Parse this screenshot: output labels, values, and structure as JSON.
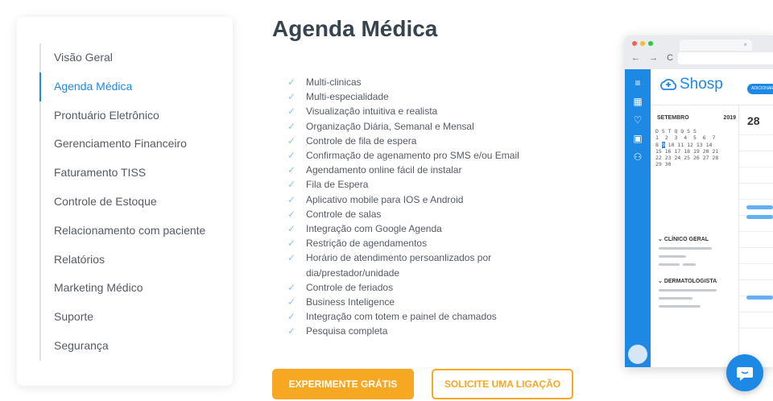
{
  "sidebar": {
    "items": [
      {
        "label": "Visão Geral",
        "active": false
      },
      {
        "label": "Agenda Médica",
        "active": true
      },
      {
        "label": "Prontuário Eletrônico",
        "active": false
      },
      {
        "label": "Gerenciamento Financeiro",
        "active": false
      },
      {
        "label": "Faturamento TISS",
        "active": false
      },
      {
        "label": "Controle de Estoque",
        "active": false
      },
      {
        "label": "Relacionamento com paciente",
        "active": false
      },
      {
        "label": "Relatórios",
        "active": false
      },
      {
        "label": "Marketing Médico",
        "active": false
      },
      {
        "label": "Suporte",
        "active": false
      },
      {
        "label": "Segurança",
        "active": false
      }
    ]
  },
  "main": {
    "title": "Agenda Médica",
    "features": [
      "Multi-clinicas",
      "Multi-especialidade",
      "Visualização intuitiva e realista",
      "Organização Diária, Semanal e Mensal",
      "Controle de fila de espera",
      "Confirmação de agenamento pro SMS e/ou Email",
      "Agendamento online fácil de instalar",
      "Fila de Espera",
      "Aplicativo mobile para IOS e Android",
      "Controle de salas",
      "Integração com Google Agenda",
      "Restrição de agendamentos",
      "Horário de atendimento persoanlizados por dia/prestador/unidade",
      "Controle de feriados",
      "Business Inteligence",
      "Integração com totem e painel de chamados",
      "Pesquisa completa"
    ],
    "cta_primary": "EXPERIMENTE GRÁTIS",
    "cta_secondary": "SOLICITE UMA LIGAÇÃO"
  },
  "mockup": {
    "brand": "Shosp",
    "add_button": "ADICIONAR",
    "tab_close": "×",
    "nav_arrows": "← → C",
    "calendar": {
      "month": "SETEMBRO",
      "year": "2019",
      "weekdays": "D S T Q Q S S",
      "rows": [
        "1  2  3  4  5  6  7",
        "8  9 10 11 12 13 14",
        "15 16 17 18 19 20 21",
        "22 23 24 25 26 27 28",
        "29 30"
      ],
      "selected_day": "9"
    },
    "groups": [
      "CLÍNICO GERAL",
      "DERMATOLOGISTA"
    ],
    "day_number": "28"
  },
  "colors": {
    "accent": "#1e88e5",
    "cta": "#f7a823",
    "check": "#8fc3f0"
  }
}
